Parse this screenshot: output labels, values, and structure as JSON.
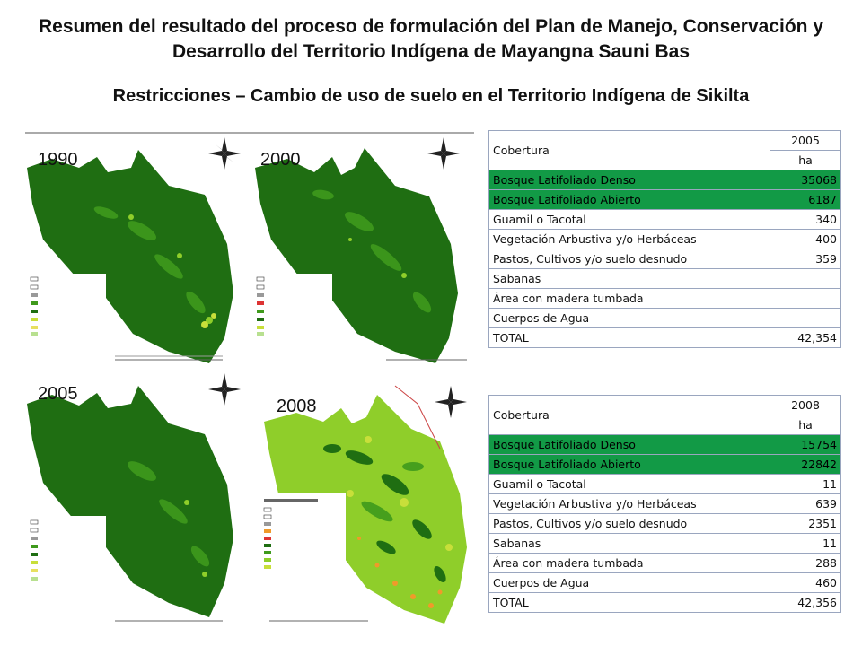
{
  "title": "Resumen del resultado del proceso de formulación del Plan de Manejo, Conservación y Desarrollo del Territorio Indígena de Mayangna Sauni Bas",
  "subtitle": "Restricciones – Cambio de uso de suelo en el Territorio Indígena de Sikilta",
  "maps": [
    {
      "year": "1990",
      "caption": "Escala Gráfica - Kilometros"
    },
    {
      "year": "2000",
      "caption": "Escala Gráfica - Kilometros"
    },
    {
      "year": "2005",
      "caption": "Escala Gráfica - Kilometros"
    },
    {
      "year": "2008",
      "caption": "Escala Gráfica - Kilometros"
    }
  ],
  "colors": {
    "dense_forest": "#1f6e12",
    "open_forest": "#3f9a1c",
    "light_green": "#8fce2a",
    "yellow_green": "#c8df3a",
    "orange": "#f09a2a",
    "table_green": "#129a46"
  },
  "tables": [
    {
      "header_label": "Cobertura",
      "year": "2005",
      "unit": "ha",
      "rows": [
        {
          "label": "Bosque Latifoliado Denso",
          "value": "35068",
          "highlight": true
        },
        {
          "label": "Bosque Latifoliado Abierto",
          "value": "6187",
          "highlight": true
        },
        {
          "label": "Guamil o Tacotal",
          "value": "340",
          "highlight": false
        },
        {
          "label": "Vegetación Arbustiva y/o Herbáceas",
          "value": "400",
          "highlight": false
        },
        {
          "label": "Pastos, Cultivos y/o suelo desnudo",
          "value": "359",
          "highlight": false
        },
        {
          "label": "Sabanas",
          "value": "",
          "highlight": false
        },
        {
          "label": "Área con madera tumbada",
          "value": "",
          "highlight": false
        },
        {
          "label": "Cuerpos de Agua",
          "value": "",
          "highlight": false
        },
        {
          "label": "TOTAL",
          "value": "42,354",
          "highlight": false
        }
      ]
    },
    {
      "header_label": "Cobertura",
      "year": "2008",
      "unit": "ha",
      "rows": [
        {
          "label": "Bosque Latifoliado Denso",
          "value": "15754",
          "highlight": true
        },
        {
          "label": "Bosque Latifoliado Abierto",
          "value": "22842",
          "highlight": true
        },
        {
          "label": "Guamil o Tacotal",
          "value": "11",
          "highlight": false
        },
        {
          "label": "Vegetación Arbustiva y/o Herbáceas",
          "value": "639",
          "highlight": false
        },
        {
          "label": "Pastos, Cultivos y/o suelo desnudo",
          "value": "2351",
          "highlight": false
        },
        {
          "label": "Sabanas",
          "value": "11",
          "highlight": false
        },
        {
          "label": "Área con madera tumbada",
          "value": "288",
          "highlight": false
        },
        {
          "label": "Cuerpos de Agua",
          "value": "460",
          "highlight": false
        },
        {
          "label": "TOTAL",
          "value": "42,356",
          "highlight": false
        }
      ]
    }
  ]
}
